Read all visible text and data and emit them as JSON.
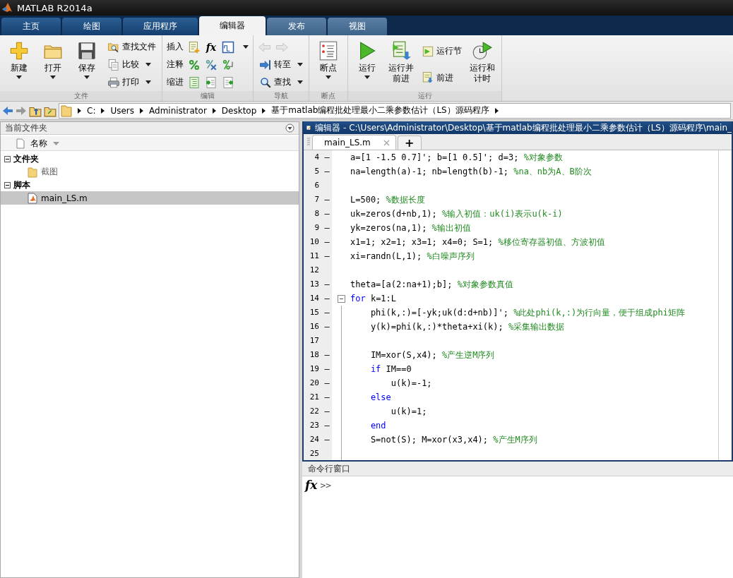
{
  "window": {
    "title": "MATLAB R2014a"
  },
  "tabs": [
    {
      "label": "主页",
      "selected": false
    },
    {
      "label": "绘图",
      "selected": false
    },
    {
      "label": "应用程序",
      "selected": false
    },
    {
      "label": "编辑器",
      "selected": true
    },
    {
      "label": "发布",
      "selected": false
    },
    {
      "label": "视图",
      "selected": false
    }
  ],
  "toolstrip": {
    "sections": [
      {
        "label": "文件",
        "items": [
          {
            "kind": "large",
            "label": "新建",
            "dropdown": true
          },
          {
            "kind": "large",
            "label": "打开",
            "dropdown": true
          },
          {
            "kind": "large",
            "label": "保存",
            "dropdown": true
          },
          {
            "kind": "stack",
            "rows": [
              {
                "label": "查找文件",
                "dropdown": false
              },
              {
                "label": "比较",
                "dropdown": true
              },
              {
                "label": "打印",
                "dropdown": true
              }
            ]
          }
        ]
      },
      {
        "label": "编辑",
        "items": [
          {
            "kind": "edit_rows",
            "rows": [
              {
                "label": "插入",
                "symbol": "fx",
                "dropdown": true
              },
              {
                "label": "注释",
                "dropdown": false
              },
              {
                "label": "缩进",
                "dropdown": false
              }
            ]
          }
        ]
      },
      {
        "label": "导航",
        "items": [
          {
            "kind": "nav",
            "rows": [
              {
                "label": "转至",
                "dropdown": true
              },
              {
                "label": "查找",
                "dropdown": true
              }
            ]
          }
        ]
      },
      {
        "label": "断点",
        "items": [
          {
            "kind": "large",
            "label": "断点",
            "dropdown": true
          }
        ]
      },
      {
        "label": "运行",
        "items": [
          {
            "kind": "large",
            "label": "运行",
            "dropdown": true
          },
          {
            "kind": "large",
            "label": "运行并前进",
            "dropdown": false
          },
          {
            "kind": "stack",
            "rows": [
              {
                "label": "运行节",
                "dropdown": false
              },
              {
                "label": "前进",
                "dropdown": false
              }
            ]
          },
          {
            "kind": "large",
            "label": "运行和计时",
            "dropdown": false
          }
        ]
      }
    ]
  },
  "address_bar": {
    "path": [
      "C:",
      "Users",
      "Administrator",
      "Desktop",
      "基于matlab编程批处理最小二乘参数估计（LS）源码程序"
    ]
  },
  "file_browser": {
    "title": "当前文件夹",
    "column": "名称",
    "groups": [
      {
        "label": "文件夹",
        "expanded": true,
        "children": [
          {
            "name": "截图",
            "kind": "folder",
            "selected": false
          }
        ]
      },
      {
        "label": "脚本",
        "expanded": true,
        "children": [
          {
            "name": "main_LS.m",
            "kind": "script",
            "selected": true
          }
        ]
      }
    ]
  },
  "editor": {
    "title": "编辑器 - C:\\Users\\Administrator\\Desktop\\基于matlab编程批处理最小二乘参数估计（LS）源码程序\\main_",
    "tabs": [
      {
        "label": "main_LS.m",
        "selected": true
      }
    ],
    "add_tab": "+",
    "lines": [
      {
        "number": "4",
        "marker": "–",
        "tokens": [
          {
            "kind": "code",
            "text": "a=[1 -1.5 0.7]'; b=[1 0.5]'; d=3; "
          },
          {
            "kind": "comment",
            "text": "%对象参数"
          }
        ]
      },
      {
        "number": "5",
        "marker": "–",
        "tokens": [
          {
            "kind": "code",
            "text": "na=length(a)-1; nb=length(b)-1; "
          },
          {
            "kind": "comment",
            "text": "%na、nb为A、B阶次"
          }
        ]
      },
      {
        "number": "6"
      },
      {
        "number": "7",
        "marker": "–",
        "tokens": [
          {
            "kind": "code",
            "text": "L=500; "
          },
          {
            "kind": "comment",
            "text": "%数据长度"
          }
        ]
      },
      {
        "number": "8",
        "marker": "–",
        "tokens": [
          {
            "kind": "code",
            "text": "uk=zeros(d+nb,1); "
          },
          {
            "kind": "comment",
            "text": "%输入初值：uk(i)表示u(k-i)"
          }
        ]
      },
      {
        "number": "9",
        "marker": "–",
        "tokens": [
          {
            "kind": "code",
            "text": "yk=zeros(na,1); "
          },
          {
            "kind": "comment",
            "text": "%输出初值"
          }
        ]
      },
      {
        "number": "10",
        "marker": "–",
        "tokens": [
          {
            "kind": "code",
            "text": "x1=1; x2=1; x3=1; x4=0; S=1; "
          },
          {
            "kind": "comment",
            "text": "%移位寄存器初值、方波初值"
          }
        ]
      },
      {
        "number": "11",
        "marker": "–",
        "tokens": [
          {
            "kind": "code",
            "text": "xi=randn(L,1); "
          },
          {
            "kind": "comment",
            "text": "%白噪声序列"
          }
        ]
      },
      {
        "number": "12"
      },
      {
        "number": "13",
        "marker": "–",
        "tokens": [
          {
            "kind": "code",
            "text": "theta=[a(2:na+1);b]; "
          },
          {
            "kind": "comment",
            "text": "%对象参数真值"
          }
        ]
      },
      {
        "number": "14",
        "marker": "–",
        "kind": "fold_start",
        "tokens": [
          {
            "kind": "keyword",
            "text": "for"
          },
          {
            "kind": "code",
            "text": " k=1:L"
          }
        ]
      },
      {
        "number": "15",
        "marker": "–",
        "kind": "in_block",
        "tokens": [
          {
            "kind": "code",
            "text": "    phi(k,:)=[-yk;uk(d:d+nb)]'; "
          },
          {
            "kind": "comment",
            "text": "%此处phi(k,:)为行向量，便于组成phi矩阵"
          }
        ]
      },
      {
        "number": "16",
        "marker": "–",
        "kind": "in_block",
        "tokens": [
          {
            "kind": "code",
            "text": "    y(k)=phi(k,:)*theta+xi(k); "
          },
          {
            "kind": "comment",
            "text": "%采集输出数据"
          }
        ]
      },
      {
        "number": "17",
        "kind": "in_block"
      },
      {
        "number": "18",
        "marker": "–",
        "kind": "in_block",
        "tokens": [
          {
            "kind": "code",
            "text": "    IM=xor(S,x4); "
          },
          {
            "kind": "comment",
            "text": "%产生逆M序列"
          }
        ]
      },
      {
        "number": "19",
        "marker": "–",
        "kind": "in_block",
        "tokens": [
          {
            "kind": "keyword",
            "text": "    if"
          },
          {
            "kind": "code",
            "text": " IM==0"
          }
        ]
      },
      {
        "number": "20",
        "marker": "–",
        "kind": "in_block",
        "tokens": [
          {
            "kind": "code",
            "text": "        u(k)=-1;"
          }
        ]
      },
      {
        "number": "21",
        "marker": "–",
        "kind": "in_block",
        "tokens": [
          {
            "kind": "keyword",
            "text": "    else"
          }
        ]
      },
      {
        "number": "22",
        "marker": "–",
        "kind": "in_block",
        "tokens": [
          {
            "kind": "code",
            "text": "        u(k)=1;"
          }
        ]
      },
      {
        "number": "23",
        "marker": "–",
        "kind": "in_block",
        "tokens": [
          {
            "kind": "keyword",
            "text": "    end"
          }
        ]
      },
      {
        "number": "24",
        "marker": "–",
        "kind": "in_block",
        "tokens": [
          {
            "kind": "code",
            "text": "    S=not(S); M=xor(x3,x4); "
          },
          {
            "kind": "comment",
            "text": "%产生M序列"
          }
        ]
      },
      {
        "number": "25",
        "kind": "in_block"
      }
    ]
  },
  "command_window": {
    "title": "命令行窗口",
    "symbol": "fx",
    "prompt": ">>"
  }
}
